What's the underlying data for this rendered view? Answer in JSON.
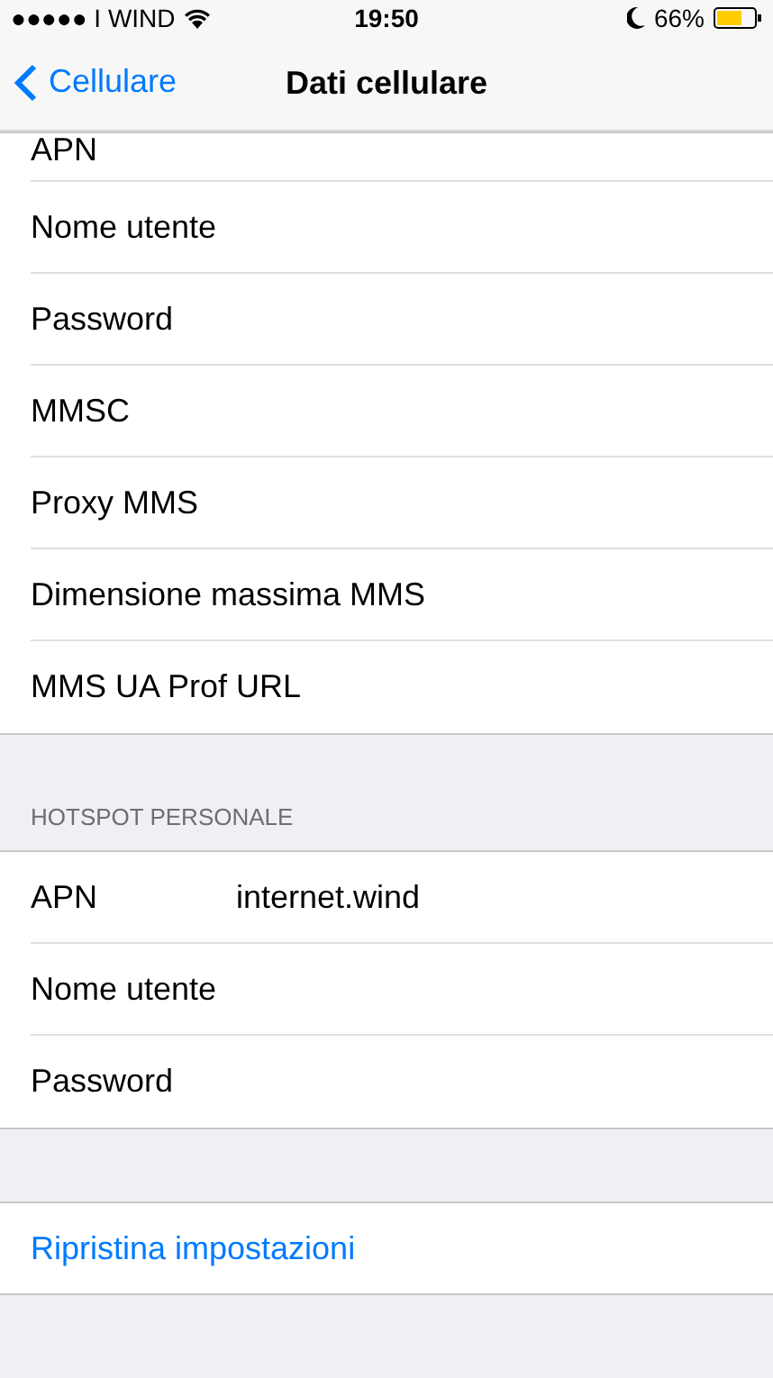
{
  "status_bar": {
    "carrier": "●●●●● I WIND",
    "time": "19:50",
    "battery": "66%"
  },
  "nav": {
    "back": "Cellulare",
    "title": "Dati cellulare"
  },
  "sections": [
    {
      "rows": [
        {
          "label": "APN"
        },
        {
          "label": "Nome utente"
        },
        {
          "label": "Password"
        },
        {
          "label": "MMSC"
        },
        {
          "label": "Proxy MMS"
        },
        {
          "label": "Dimensione massima MMS"
        },
        {
          "label": "MMS UA Prof URL"
        }
      ]
    },
    {
      "header": "HOTSPOT PERSONALE",
      "rows": [
        {
          "label": "APN",
          "value": "internet.wind"
        },
        {
          "label": "Nome utente"
        },
        {
          "label": "Password"
        }
      ]
    }
  ],
  "reset_button": "Ripristina impostazioni"
}
